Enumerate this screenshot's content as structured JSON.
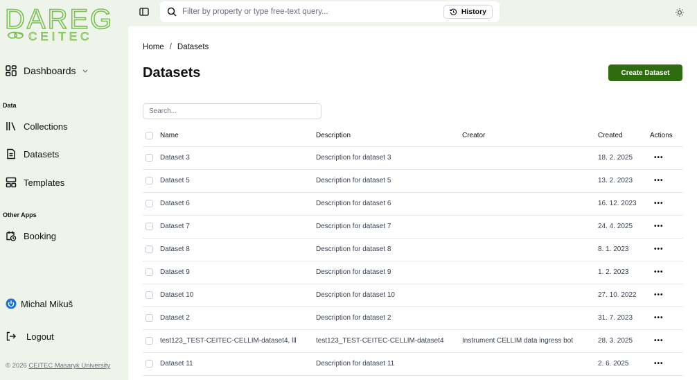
{
  "sidebar": {
    "logo_top": "DAREG",
    "logo_bottom": "CEITEC",
    "dashboards": "Dashboards",
    "section_data": "Data",
    "collections": "Collections",
    "datasets": "Datasets",
    "templates": "Templates",
    "section_other": "Other Apps",
    "booking": "Booking",
    "user_name": "Michal Mikuš",
    "logout": "Logout",
    "footer_prefix": "© 2026 ",
    "footer_link": "CEITEC Masaryk University"
  },
  "topbar": {
    "search_placeholder": "Filter by property or type free-text query...",
    "history_label": "History"
  },
  "main": {
    "breadcrumb_home": "Home",
    "breadcrumb_sep": "/",
    "breadcrumb_current": "Datasets",
    "title": "Datasets",
    "create_label": "Create Dataset",
    "search_placeholder": "Search..."
  },
  "table": {
    "headers": {
      "name": "Name",
      "description": "Description",
      "creator": "Creator",
      "created": "Created",
      "actions": "Actions"
    },
    "rows": [
      {
        "name": "Dataset 3",
        "description": "Description for dataset 3",
        "creator": "",
        "created": "18. 2. 2025"
      },
      {
        "name": "Dataset 5",
        "description": "Description for dataset 5",
        "creator": "",
        "created": "13. 2. 2023"
      },
      {
        "name": "Dataset 6",
        "description": "Description for dataset 6",
        "creator": "",
        "created": "16. 12. 2023"
      },
      {
        "name": "Dataset 7",
        "description": "Description for dataset 7",
        "creator": "",
        "created": "24. 4. 2025"
      },
      {
        "name": "Dataset 8",
        "description": "Description for dataset 8",
        "creator": "",
        "created": "8. 1. 2023"
      },
      {
        "name": "Dataset 9",
        "description": "Description for dataset 9",
        "creator": "",
        "created": "1. 2. 2023"
      },
      {
        "name": "Dataset 10",
        "description": "Description for dataset 10",
        "creator": "",
        "created": "27. 10. 2022"
      },
      {
        "name": "Dataset 2",
        "description": "Description for dataset 2",
        "creator": "",
        "created": "31. 7. 2023"
      },
      {
        "name": "test123_TEST-CEITEC-CELLIM-dataset4, lll",
        "description": "test123_TEST-CEITEC-CELLIM-dataset4",
        "creator": "Instrument CELLIM data ingress bot",
        "created": "28. 3. 2025"
      },
      {
        "name": "Dataset 11",
        "description": "Description for dataset 11",
        "creator": "",
        "created": "2. 6. 2025"
      }
    ],
    "actions_glyph": "•••"
  },
  "colors": {
    "sidebar_bg": "#eef4ea",
    "accent": "#2f6b10",
    "logo": "#7bbf55",
    "power_icon": "#1d6fd1"
  }
}
